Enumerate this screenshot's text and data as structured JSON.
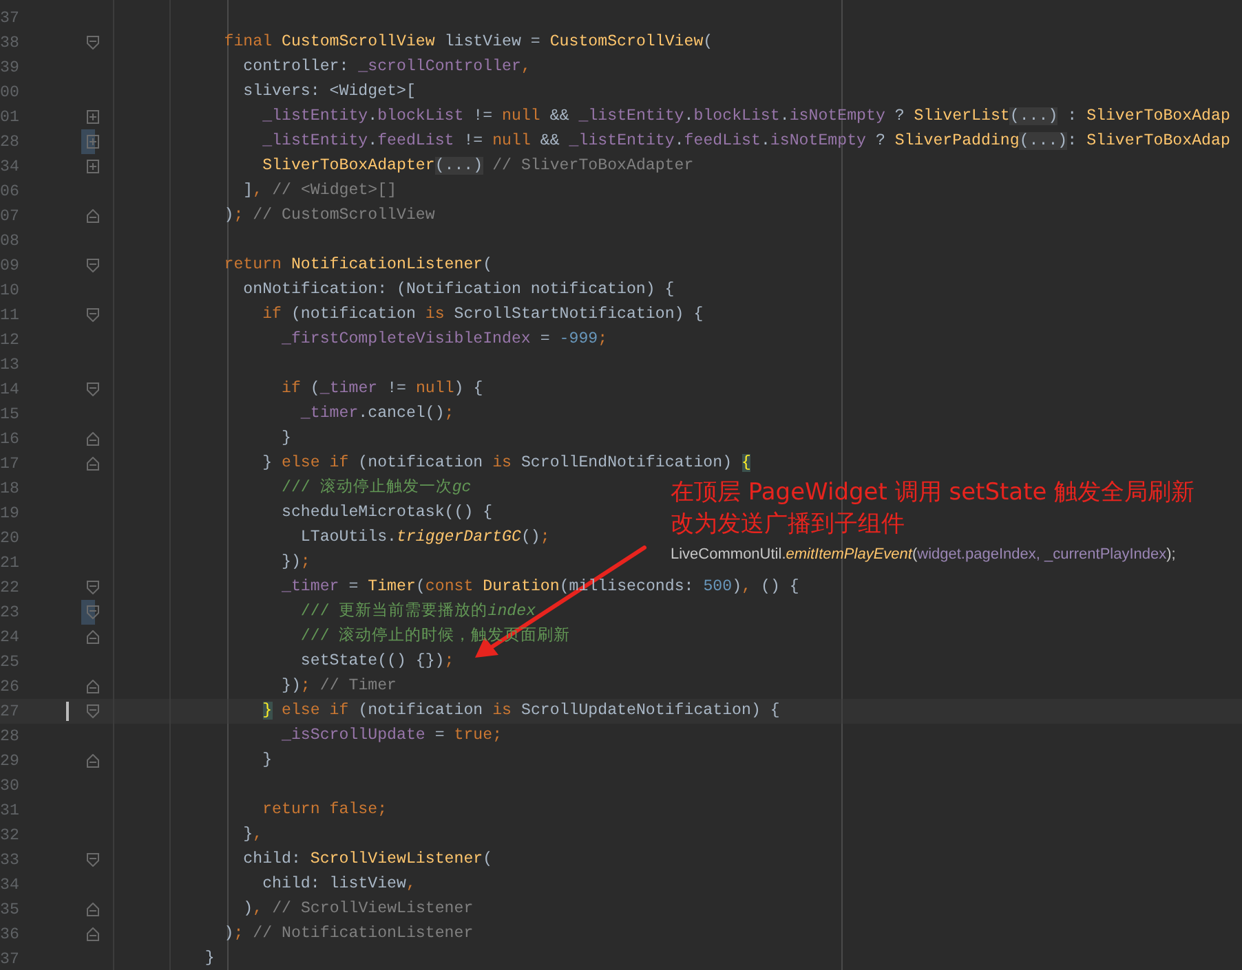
{
  "editor": {
    "lines": [
      {
        "number": "37",
        "kind": "plain",
        "current": false,
        "highlight": false
      },
      {
        "number": "38",
        "kind": "open",
        "current": false,
        "highlight": false,
        "tokens": [
          {
            "text": "      final",
            "kind": "kw"
          },
          {
            "text": " CustomScrollView",
            "kind": "cls"
          },
          {
            "text": " listView = ",
            "kind": "p"
          },
          {
            "text": "CustomScrollView",
            "kind": "cls"
          },
          {
            "text": "(",
            "kind": "p"
          }
        ]
      },
      {
        "number": "39",
        "kind": "plain",
        "current": false,
        "highlight": false,
        "tokens": [
          {
            "text": "        controller: ",
            "kind": "p"
          },
          {
            "text": "_scrollController",
            "kind": "field"
          },
          {
            "text": ",",
            "kind": "kw"
          }
        ]
      },
      {
        "number": "00",
        "kind": "plain",
        "current": false,
        "highlight": false,
        "tokens": [
          {
            "text": "        slivers: <Widget>[",
            "kind": "p"
          }
        ]
      },
      {
        "number": "01",
        "kind": "collapsed",
        "current": false,
        "highlight": false,
        "tokens": [
          {
            "text": "          _listEntity",
            "kind": "field"
          },
          {
            "text": ".",
            "kind": "p"
          },
          {
            "text": "blockList",
            "kind": "field"
          },
          {
            "text": " != ",
            "kind": "p"
          },
          {
            "text": "null",
            "kind": "kw"
          },
          {
            "text": " && ",
            "kind": "p"
          },
          {
            "text": "_listEntity",
            "kind": "field"
          },
          {
            "text": ".",
            "kind": "p"
          },
          {
            "text": "blockList",
            "kind": "field"
          },
          {
            "text": ".",
            "kind": "p"
          },
          {
            "text": "isNotEmpty",
            "kind": "field"
          },
          {
            "text": " ? ",
            "kind": "p"
          },
          {
            "text": "SliverList",
            "kind": "cls"
          },
          {
            "text": "(...)",
            "kind": "fold"
          },
          {
            "text": " : ",
            "kind": "p"
          },
          {
            "text": "SliverToBoxAdap",
            "kind": "cls"
          }
        ]
      },
      {
        "number": "28",
        "kind": "collapsed",
        "current": false,
        "highlight": true,
        "tokens": [
          {
            "text": "          _listEntity",
            "kind": "field"
          },
          {
            "text": ".",
            "kind": "p"
          },
          {
            "text": "feedList",
            "kind": "field"
          },
          {
            "text": " != ",
            "kind": "p"
          },
          {
            "text": "null",
            "kind": "kw"
          },
          {
            "text": " && ",
            "kind": "p"
          },
          {
            "text": "_listEntity",
            "kind": "field"
          },
          {
            "text": ".",
            "kind": "p"
          },
          {
            "text": "feedList",
            "kind": "field"
          },
          {
            "text": ".",
            "kind": "p"
          },
          {
            "text": "isNotEmpty",
            "kind": "field"
          },
          {
            "text": " ? ",
            "kind": "p"
          },
          {
            "text": "SliverPadding",
            "kind": "cls"
          },
          {
            "text": "(...)",
            "kind": "fold"
          },
          {
            "text": ": ",
            "kind": "p"
          },
          {
            "text": "SliverToBoxAdap",
            "kind": "cls"
          }
        ]
      },
      {
        "number": "34",
        "kind": "collapsed",
        "current": false,
        "highlight": false,
        "tokens": [
          {
            "text": "          SliverToBoxAdapter",
            "kind": "cls"
          },
          {
            "text": "(...)",
            "kind": "fold"
          },
          {
            "text": " // SliverToBoxAdapter",
            "kind": "cm"
          }
        ]
      },
      {
        "number": "06",
        "kind": "plain",
        "current": false,
        "highlight": false,
        "tokens": [
          {
            "text": "        ]",
            "kind": "p"
          },
          {
            "text": ",",
            "kind": "kw"
          },
          {
            "text": " // <Widget>[]",
            "kind": "cm"
          }
        ]
      },
      {
        "number": "07",
        "kind": "close",
        "current": false,
        "highlight": false,
        "tokens": [
          {
            "text": "      )",
            "kind": "p"
          },
          {
            "text": ";",
            "kind": "kw"
          },
          {
            "text": " // CustomScrollView",
            "kind": "cm"
          }
        ]
      },
      {
        "number": "08",
        "kind": "plain",
        "current": false,
        "highlight": false
      },
      {
        "number": "09",
        "kind": "open",
        "current": false,
        "highlight": false,
        "tokens": [
          {
            "text": "      return",
            "kind": "kw"
          },
          {
            "text": " NotificationListener",
            "kind": "cls"
          },
          {
            "text": "(",
            "kind": "p"
          }
        ]
      },
      {
        "number": "10",
        "kind": "plain",
        "current": false,
        "highlight": false,
        "tokens": [
          {
            "text": "        onNotification: (Notification notification) {",
            "kind": "p"
          }
        ]
      },
      {
        "number": "11",
        "kind": "open",
        "current": false,
        "highlight": false,
        "tokens": [
          {
            "text": "          if",
            "kind": "kw"
          },
          {
            "text": " (notification ",
            "kind": "p"
          },
          {
            "text": "is",
            "kind": "kw"
          },
          {
            "text": " ScrollStartNotification) {",
            "kind": "p"
          }
        ]
      },
      {
        "number": "12",
        "kind": "plain",
        "current": false,
        "highlight": false,
        "tokens": [
          {
            "text": "            _firstCompleteVisibleIndex",
            "kind": "field"
          },
          {
            "text": " = ",
            "kind": "p"
          },
          {
            "text": "-999",
            "kind": "num"
          },
          {
            "text": ";",
            "kind": "kw"
          }
        ]
      },
      {
        "number": "13",
        "kind": "plain",
        "current": false,
        "highlight": false
      },
      {
        "number": "14",
        "kind": "open",
        "current": false,
        "highlight": false,
        "tokens": [
          {
            "text": "            if",
            "kind": "kw"
          },
          {
            "text": " (",
            "kind": "p"
          },
          {
            "text": "_timer",
            "kind": "field"
          },
          {
            "text": " != ",
            "kind": "p"
          },
          {
            "text": "null",
            "kind": "kw"
          },
          {
            "text": ") {",
            "kind": "p"
          }
        ]
      },
      {
        "number": "15",
        "kind": "plain",
        "current": false,
        "highlight": false,
        "tokens": [
          {
            "text": "              _timer",
            "kind": "field"
          },
          {
            "text": ".cancel()",
            "kind": "p"
          },
          {
            "text": ";",
            "kind": "kw"
          }
        ]
      },
      {
        "number": "16",
        "kind": "close",
        "current": false,
        "highlight": false,
        "tokens": [
          {
            "text": "            }",
            "kind": "p"
          }
        ]
      },
      {
        "number": "17",
        "kind": "close",
        "current": false,
        "highlight": false,
        "tokens": [
          {
            "text": "          } ",
            "kind": "p"
          },
          {
            "text": "else if",
            "kind": "kw"
          },
          {
            "text": " (notification ",
            "kind": "p"
          },
          {
            "text": "is",
            "kind": "kw"
          },
          {
            "text": " ScrollEndNotification) ",
            "kind": "p"
          },
          {
            "text": "{",
            "kind": "match"
          }
        ]
      },
      {
        "number": "18",
        "kind": "plain",
        "current": false,
        "highlight": false,
        "tokens": [
          {
            "text": "            /// 滚动停止触发一次",
            "kind": "doc"
          },
          {
            "text": "gc",
            "kind": "docit"
          }
        ]
      },
      {
        "number": "19",
        "kind": "plain",
        "current": false,
        "highlight": false,
        "tokens": [
          {
            "text": "            scheduleMicrotask(() {",
            "kind": "p"
          }
        ]
      },
      {
        "number": "20",
        "kind": "plain",
        "current": false,
        "highlight": false,
        "tokens": [
          {
            "text": "              LTaoUtils.",
            "kind": "p"
          },
          {
            "text": "triggerDartGC",
            "kind": "fn"
          },
          {
            "text": "()",
            "kind": "p"
          },
          {
            "text": ";",
            "kind": "kw"
          }
        ]
      },
      {
        "number": "21",
        "kind": "plain",
        "current": false,
        "highlight": false,
        "tokens": [
          {
            "text": "            })",
            "kind": "p"
          },
          {
            "text": ";",
            "kind": "kw"
          }
        ]
      },
      {
        "number": "22",
        "kind": "open",
        "current": false,
        "highlight": false,
        "tokens": [
          {
            "text": "            _timer",
            "kind": "field"
          },
          {
            "text": " = ",
            "kind": "p"
          },
          {
            "text": "Timer",
            "kind": "cls"
          },
          {
            "text": "(",
            "kind": "p"
          },
          {
            "text": "const",
            "kind": "kw"
          },
          {
            "text": " Duration",
            "kind": "cls"
          },
          {
            "text": "(milliseconds: ",
            "kind": "p"
          },
          {
            "text": "500",
            "kind": "num"
          },
          {
            "text": ")",
            "kind": "p"
          },
          {
            "text": ",",
            "kind": "kw"
          },
          {
            "text": " () {",
            "kind": "p"
          }
        ]
      },
      {
        "number": "23",
        "kind": "open",
        "current": false,
        "highlight": true,
        "tokens": [
          {
            "text": "              /// 更新当前需要播放的",
            "kind": "doc"
          },
          {
            "text": "index",
            "kind": "docit"
          }
        ]
      },
      {
        "number": "24",
        "kind": "close",
        "current": false,
        "highlight": false,
        "tokens": [
          {
            "text": "              /// 滚动停止的时候，触发页面刷新",
            "kind": "doc"
          }
        ]
      },
      {
        "number": "25",
        "kind": "plain",
        "current": false,
        "highlight": false,
        "tokens": [
          {
            "text": "              setState(() {})",
            "kind": "p"
          },
          {
            "text": ";",
            "kind": "kw"
          }
        ]
      },
      {
        "number": "26",
        "kind": "close",
        "current": false,
        "highlight": false,
        "tokens": [
          {
            "text": "            })",
            "kind": "p"
          },
          {
            "text": ";",
            "kind": "kw"
          },
          {
            "text": " // Timer",
            "kind": "cm"
          }
        ]
      },
      {
        "number": "27",
        "kind": "open",
        "current": true,
        "highlight": false,
        "tokens": [
          {
            "text": "          }",
            "kind": "match"
          },
          {
            "text": " else if",
            "kind": "kw"
          },
          {
            "text": " (notification ",
            "kind": "p"
          },
          {
            "text": "is",
            "kind": "kw"
          },
          {
            "text": " ScrollUpdateNotification) {",
            "kind": "p"
          }
        ]
      },
      {
        "number": "28",
        "kind": "plain",
        "current": false,
        "highlight": false,
        "tokens": [
          {
            "text": "            _isScrollUpdate",
            "kind": "field"
          },
          {
            "text": " = ",
            "kind": "p"
          },
          {
            "text": "true",
            "kind": "kw"
          },
          {
            "text": ";",
            "kind": "kw"
          }
        ]
      },
      {
        "number": "29",
        "kind": "close",
        "current": false,
        "highlight": false,
        "tokens": [
          {
            "text": "          }",
            "kind": "p"
          }
        ]
      },
      {
        "number": "30",
        "kind": "plain",
        "current": false,
        "highlight": false
      },
      {
        "number": "31",
        "kind": "plain",
        "current": false,
        "highlight": false,
        "tokens": [
          {
            "text": "          return false;",
            "kind": "kw"
          }
        ]
      },
      {
        "number": "32",
        "kind": "plain",
        "current": false,
        "highlight": false,
        "tokens": [
          {
            "text": "        }",
            "kind": "p"
          },
          {
            "text": ",",
            "kind": "kw"
          }
        ]
      },
      {
        "number": "33",
        "kind": "open",
        "current": false,
        "highlight": false,
        "tokens": [
          {
            "text": "        child: ",
            "kind": "p"
          },
          {
            "text": "ScrollViewListener",
            "kind": "cls"
          },
          {
            "text": "(",
            "kind": "p"
          }
        ]
      },
      {
        "number": "34",
        "kind": "plain",
        "current": false,
        "highlight": false,
        "tokens": [
          {
            "text": "          child: listView",
            "kind": "p"
          },
          {
            "text": ",",
            "kind": "kw"
          }
        ]
      },
      {
        "number": "35",
        "kind": "close",
        "current": false,
        "highlight": false,
        "tokens": [
          {
            "text": "        )",
            "kind": "p"
          },
          {
            "text": ",",
            "kind": "kw"
          },
          {
            "text": " // ScrollViewListener",
            "kind": "cm"
          }
        ]
      },
      {
        "number": "36",
        "kind": "close",
        "current": false,
        "highlight": false,
        "tokens": [
          {
            "text": "      )",
            "kind": "p"
          },
          {
            "text": ";",
            "kind": "kw"
          },
          {
            "text": " // NotificationListener",
            "kind": "cm"
          }
        ]
      },
      {
        "number": "37",
        "kind": "plain",
        "current": false,
        "highlight": false,
        "tokens": [
          {
            "text": "    }",
            "kind": "p"
          }
        ]
      }
    ]
  },
  "annotation": {
    "lines": [
      "在顶层 PageWidget 调用 setState 触发全局刷新",
      "改为发送广播到子组件"
    ],
    "snippet": [
      {
        "text": "LiveCommonUtil.",
        "kind": "p"
      },
      {
        "text": "emitItemPlayEvent",
        "kind": "fn"
      },
      {
        "text": "(",
        "kind": "p"
      },
      {
        "text": "widget.pageIndex, _currentPlayIndex",
        "kind": "field"
      },
      {
        "text": ");",
        "kind": "p"
      }
    ]
  }
}
